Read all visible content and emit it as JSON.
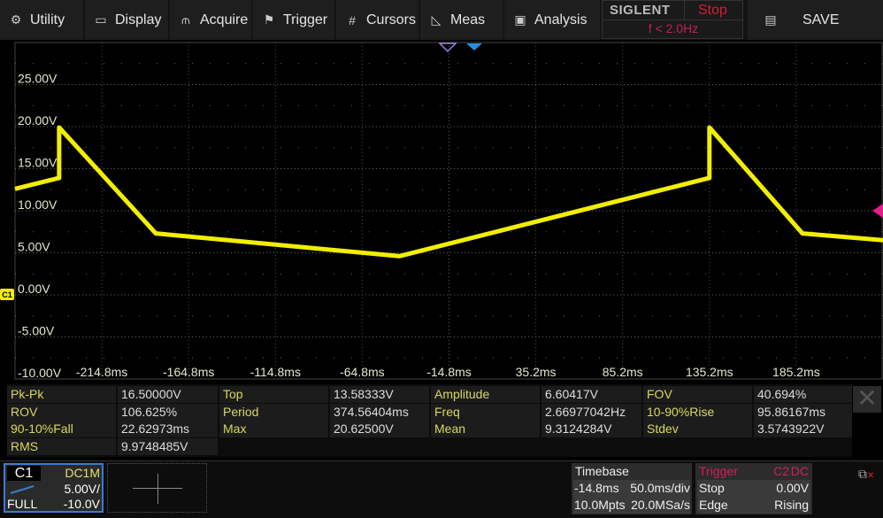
{
  "menu": {
    "items": [
      {
        "label": "Utility",
        "icon": "gear-icon",
        "glyph": "⚙"
      },
      {
        "label": "Display",
        "icon": "monitor-icon",
        "glyph": "▭"
      },
      {
        "label": "Acquire",
        "icon": "acquire-icon",
        "glyph": "⫙"
      },
      {
        "label": "Trigger",
        "icon": "flag-icon",
        "glyph": "⚑"
      },
      {
        "label": "Cursors",
        "icon": "cursors-icon",
        "glyph": "#"
      },
      {
        "label": "Meas",
        "icon": "ruler-triangle-icon",
        "glyph": "◺"
      },
      {
        "label": "Analysis",
        "icon": "analysis-icon",
        "glyph": "▣"
      }
    ],
    "brand": "SIGLENT",
    "run_state": "Stop",
    "freq": "f < 2.0Hz",
    "save": {
      "label": "SAVE",
      "icon": "save-icon",
      "glyph": "▤"
    }
  },
  "colors": {
    "trace": "#f2ee00",
    "grid": "#666666",
    "label": "#e6e6d0",
    "trigger_marker": "#e0208a",
    "timebase_marker": "#2a8ae6",
    "run_state": "#d02030",
    "channel_border": "#3a7bd5"
  },
  "chart_data": {
    "type": "line",
    "xunit": "ms",
    "yunit": "V",
    "xlim": [
      -264.8,
      235.2
    ],
    "ylim": [
      -10,
      30
    ],
    "y_ticks": [
      "25.00V",
      "20.00V",
      "15.00V",
      "10.00V",
      "5.00V",
      "0.00V",
      "-5.00V",
      "-10.00V"
    ],
    "y_tick_values": [
      25,
      20,
      15,
      10,
      5,
      0,
      -5,
      -10
    ],
    "x_ticks": [
      "-214.8ms",
      "-164.8ms",
      "-114.8ms",
      "-64.8ms",
      "-14.8ms",
      "35.2ms",
      "85.2ms",
      "135.2ms",
      "185.2ms"
    ],
    "x_tick_values": [
      -214.8,
      -164.8,
      -114.8,
      -64.8,
      -14.8,
      35.2,
      85.2,
      135.2,
      185.2
    ],
    "grid": true,
    "series": [
      {
        "x": [
          -264.8,
          -239.4,
          -239.4,
          -183.7,
          -43.4,
          135.2,
          135.2,
          188.8,
          235.2
        ],
        "y": [
          12.6,
          13.9,
          19.9,
          7.3,
          4.6,
          13.9,
          19.9,
          7.3,
          6.5
        ]
      }
    ]
  },
  "channel_marker": "C1",
  "measurements": [
    [
      "Pk-Pk",
      "16.50000V",
      "Top",
      "13.58333V",
      "Amplitude",
      "6.60417V",
      "FOV",
      "40.694%"
    ],
    [
      "ROV",
      "106.625%",
      "Period",
      "374.56404ms",
      "Freq",
      "2.66977042Hz",
      "10-90%Rise",
      "95.86167ms"
    ],
    [
      "90-10%Fall",
      "22.62973ms",
      "Max",
      "20.62500V",
      "Mean",
      "9.3124284V",
      "Stdev",
      "3.5743922V"
    ],
    [
      "RMS",
      "9.9748485V"
    ]
  ],
  "channel": {
    "name": "C1",
    "coupling": "DC1M",
    "scale": "5.00V/",
    "bandwidth": "FULL",
    "offset": "-10.0V"
  },
  "timebase": {
    "title": "Timebase",
    "delay": "-14.8ms",
    "scale": "50.0ms/div",
    "memory": "10.0Mpts",
    "rate": "20.0MSa/s"
  },
  "trigger": {
    "title": "Trigger",
    "source": "C2",
    "coupling": "DC",
    "state": "Stop",
    "level": "0.00V",
    "type": "Edge",
    "slope": "Rising"
  }
}
